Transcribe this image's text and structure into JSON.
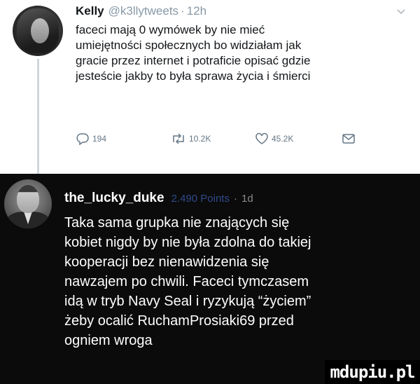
{
  "tweet": {
    "author_name": "Kelly",
    "author_handle": "@k3llytweets",
    "time": "12h",
    "lines": [
      "faceci mają 0 wymówek by nie mieć",
      "umiejętności społecznych bo widziałam jak",
      "gracie przez internet i potraficie opisać gdzie",
      "jesteście jakby to była sprawa życia i śmierci"
    ],
    "replies": "194",
    "retweets": "10.2K",
    "likes": "45.2K",
    "icons": {
      "reply": "reply-icon",
      "retweet": "retweet-icon",
      "like": "heart-icon",
      "dm": "envelope-icon",
      "menu": "chevron-down-icon"
    }
  },
  "comment": {
    "username": "the_lucky_duke",
    "points": "2.490 Points",
    "time": "1d",
    "lines": [
      "Taka sama grupka nie znających się",
      "kobiet nigdy by nie była zdolna do takiej",
      "kooperacji bez nienawidzenia się",
      "nawzajem po chwili. Faceci tymczasem",
      "idą w tryb Navy Seal i ryzykują “życiem”",
      "żeby ocalić RuchamProsiaki69 przed",
      "ogniem wroga"
    ]
  },
  "watermark": "mdupiu.pl",
  "colors": {
    "tweet_bg": "#ffffff",
    "comment_bg": "#0b0b0b",
    "muted": "#8899a6",
    "points": "#2f4a8a"
  }
}
